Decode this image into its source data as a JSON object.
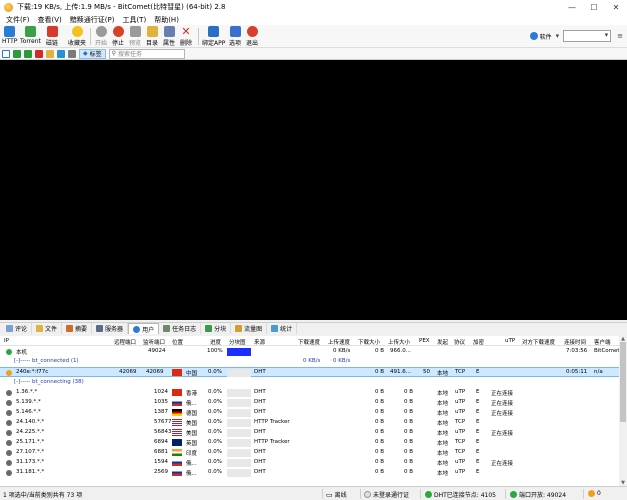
{
  "window": {
    "title": "下载:19 KB/s, 上传:1.9 MB/s - BitComet(比特彗星) (64-bit) 2.8"
  },
  "menu": [
    "文件(F)",
    "查看(V)",
    "黯黩通行证(P)",
    "工具(T)",
    "帮助(H)"
  ],
  "toolbar": {
    "buttons": [
      {
        "label": "HTTP",
        "name": "http-button",
        "color": "#2a7bd4"
      },
      {
        "label": "Torrent",
        "name": "torrent-button",
        "color": "#3aa14a"
      },
      {
        "label": "磁链",
        "name": "magnet-button",
        "color": "#d63a2a"
      },
      {
        "label": "收藏夹",
        "name": "favorites-button",
        "color": "#f4c21f"
      },
      {
        "label": "开始",
        "name": "start-button",
        "color": "#9a9a9a"
      },
      {
        "label": "停止",
        "name": "stop-button",
        "color": "#d9402a"
      },
      {
        "label": "预览",
        "name": "preview-button",
        "color": "#9a9a9a"
      },
      {
        "label": "目录",
        "name": "folder-button",
        "color": "#e3b23c"
      },
      {
        "label": "属性",
        "name": "properties-button",
        "color": "#6a7fb0"
      },
      {
        "label": "删除",
        "name": "delete-button",
        "color": "#d02a2a"
      },
      {
        "label": "绑定APP",
        "name": "bind-app-button",
        "color": "#2a6fc4"
      },
      {
        "label": "选项",
        "name": "options-button",
        "color": "#3a6fd0"
      },
      {
        "label": "退出",
        "name": "exit-button",
        "color": "#d6402a"
      }
    ],
    "soft_label": "软件"
  },
  "toolbar2": {
    "tag_label": "标签",
    "search_placeholder": "搜索任务"
  },
  "tabs": [
    {
      "label": "评论",
      "active": false
    },
    {
      "label": "文件",
      "active": false
    },
    {
      "label": "摘要",
      "active": false
    },
    {
      "label": "服务器",
      "active": false
    },
    {
      "label": "用户",
      "active": true
    },
    {
      "label": "任务日志",
      "active": false
    },
    {
      "label": "分块",
      "active": false
    },
    {
      "label": "流量图",
      "active": false
    },
    {
      "label": "统计",
      "active": false
    }
  ],
  "peer_table": {
    "columns": [
      "IP",
      "远程端口",
      "监听端口",
      "位置",
      "进度",
      "分块图",
      "来源",
      "下载速度",
      "上传速度",
      "下载大小",
      "上传大小",
      "PEX",
      "发起",
      "协议",
      "加密",
      "uTP",
      "对方下载速度",
      "连接时间",
      "客户端"
    ],
    "local": {
      "ip": "本机",
      "listen_port": "49024",
      "progress": "100%",
      "progress_fraction": 1.0,
      "down_speed": "",
      "up_speed": "0 KB/s",
      "down_size": "0 B",
      "up_size": "966.0...",
      "conn_time": "7:03:56",
      "client": "BitComet"
    },
    "group_connected": {
      "label": "[-]----- bt_connected (1)",
      "down_speed": "0 KB/s",
      "up_speed": "0 KB/s"
    },
    "connected_peer": {
      "ip": "240e:*:f77c",
      "remote_port": "42069",
      "listen_port": "42069",
      "location": "中国",
      "progress": "0.0%",
      "source": "DHT",
      "down_size": "0 B",
      "up_size": "491.6...",
      "pex": "50",
      "initiator": "本地",
      "protocol": "TCP",
      "encrypt": "E",
      "conn_time": "0:05:11",
      "client": "n/a"
    },
    "group_connecting": {
      "label": "[-]----- bt_connecting (38)"
    },
    "connecting_peers": [
      {
        "ip": "1.36.*.*",
        "listen_port": "1024",
        "location": "香港",
        "progress": "0.0%",
        "source": "DHT",
        "down_size": "0 B",
        "up_size": "0 B",
        "initiator": "本地",
        "protocol": "uTP",
        "encrypt": "E",
        "status": "正在连接",
        "flag": "hk"
      },
      {
        "ip": "5.139.*.*",
        "listen_port": "1035",
        "location": "俄...",
        "progress": "0.0%",
        "source": "DHT",
        "down_size": "0 B",
        "up_size": "0 B",
        "initiator": "本地",
        "protocol": "uTP",
        "encrypt": "E",
        "status": "正在连接",
        "flag": "ru"
      },
      {
        "ip": "5.146.*.*",
        "listen_port": "1387",
        "location": "德国",
        "progress": "0.0%",
        "source": "DHT",
        "down_size": "0 B",
        "up_size": "0 B",
        "initiator": "本地",
        "protocol": "uTP",
        "encrypt": "E",
        "status": "正在连接",
        "flag": "de"
      },
      {
        "ip": "24.140.*.*",
        "listen_port": "57677",
        "location": "美国",
        "progress": "0.0%",
        "source": "HTTP Tracker",
        "down_size": "0 B",
        "up_size": "0 B",
        "initiator": "本地",
        "protocol": "TCP",
        "encrypt": "E",
        "status": "",
        "flag": "us"
      },
      {
        "ip": "24.225.*.*",
        "listen_port": "56843",
        "location": "美国",
        "progress": "0.0%",
        "source": "DHT",
        "down_size": "0 B",
        "up_size": "0 B",
        "initiator": "本地",
        "protocol": "uTP",
        "encrypt": "E",
        "status": "正在连接",
        "flag": "us"
      },
      {
        "ip": "25.171.*.*",
        "listen_port": "6894",
        "location": "英国",
        "progress": "0.0%",
        "source": "HTTP Tracker",
        "down_size": "0 B",
        "up_size": "0 B",
        "initiator": "本地",
        "protocol": "TCP",
        "encrypt": "E",
        "status": "",
        "flag": "gb"
      },
      {
        "ip": "27.107.*.*",
        "listen_port": "6881",
        "location": "印度",
        "progress": "0.0%",
        "source": "DHT",
        "down_size": "0 B",
        "up_size": "0 B",
        "initiator": "本地",
        "protocol": "TCP",
        "encrypt": "E",
        "status": "",
        "flag": "in"
      },
      {
        "ip": "31.173.*.*",
        "listen_port": "1594",
        "location": "俄...",
        "progress": "0.0%",
        "source": "DHT",
        "down_size": "0 B",
        "up_size": "0 B",
        "initiator": "本地",
        "protocol": "uTP",
        "encrypt": "E",
        "status": "正在连接",
        "flag": "ru"
      },
      {
        "ip": "31.181.*.*",
        "listen_port": "2569",
        "location": "俄...",
        "progress": "0.0%",
        "source": "DHT",
        "down_size": "0 B",
        "up_size": "0 B",
        "initiator": "本地",
        "protocol": "uTP",
        "encrypt": "E",
        "status": "",
        "flag": "ru"
      }
    ]
  },
  "statusbar": {
    "selection": "1 项选中/当前类别共有 73 项",
    "offline": "离线",
    "login": "未登录通行证",
    "dht": "DHT已连接节点: 4105",
    "port": "端口开放: 49024",
    "count": "0"
  }
}
